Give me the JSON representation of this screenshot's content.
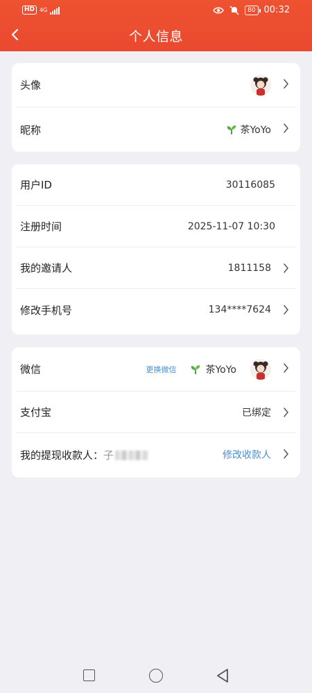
{
  "status_bar": {
    "hd_badge": "HD",
    "network": "4G",
    "time": "00:32",
    "battery": "80"
  },
  "nav": {
    "title": "个人信息",
    "back_icon": "chevron-left-icon"
  },
  "profile_card": {
    "avatar_label": "头像",
    "nickname_label": "昵称",
    "nickname_value": "茶YoYo"
  },
  "account_card": {
    "user_id_label": "用户ID",
    "user_id_value": "30116085",
    "register_time_label": "注册时间",
    "register_time_value": "2025-11-07 10:30",
    "inviter_label": "我的邀请人",
    "inviter_value": "1811158",
    "phone_label": "修改手机号",
    "phone_value": "134****7624"
  },
  "binding_card": {
    "wechat_label": "微信",
    "wechat_change_link": "更换微信",
    "wechat_name": "茶YoYo",
    "alipay_label": "支付宝",
    "alipay_status": "已绑定",
    "payee_label": "我的提现收款人：",
    "payee_name_visible": "子",
    "payee_modify_link": "修改收款人"
  },
  "colors": {
    "header": "#ea4a30",
    "background": "#f0eff4",
    "link": "#4a90d0"
  }
}
